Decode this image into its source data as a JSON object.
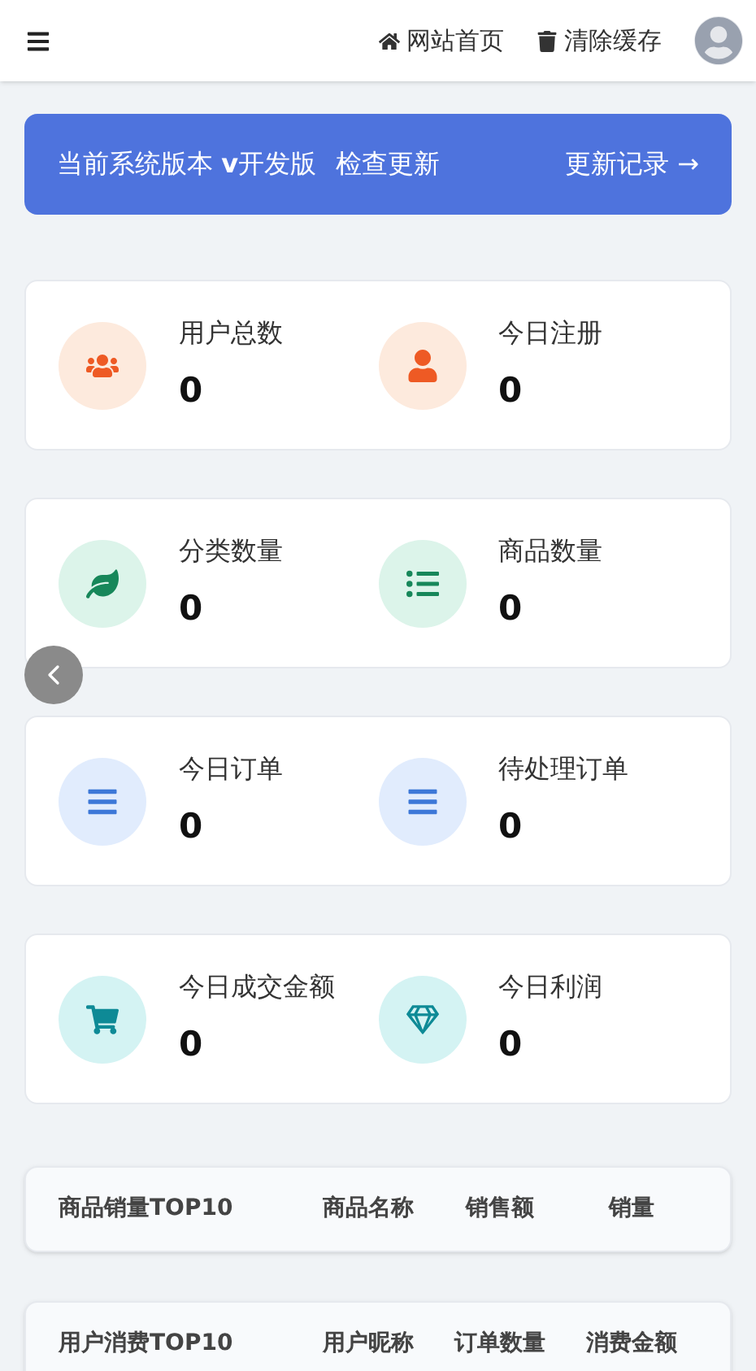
{
  "header": {
    "links": [
      {
        "kind": "home",
        "label": "网站首页"
      },
      {
        "kind": "trash",
        "label": "清除缓存"
      }
    ]
  },
  "banner": {
    "version": "当前系统版本 **v**开发版",
    "check": "检查更新",
    "changelog": "更新记录 →"
  },
  "stat_cards": [
    {
      "items": [
        {
          "kind": "users",
          "color": "#ee5a24",
          "label": "用户总数",
          "value": "0"
        },
        {
          "kind": "user",
          "color": "#ee5a24",
          "label": "今日注册",
          "value": "0"
        }
      ]
    },
    {
      "items": [
        {
          "kind": "leaf",
          "color": "#17875a",
          "label": "分类数量",
          "value": "0"
        },
        {
          "kind": "list",
          "color": "#17875a",
          "label": "商品数量",
          "value": "0"
        }
      ]
    },
    {
      "items": [
        {
          "kind": "bars",
          "color": "#3d78d8",
          "label": "今日订单",
          "value": "0"
        },
        {
          "kind": "bars",
          "color": "#3d78d8",
          "label": "待处理订单",
          "value": "0"
        }
      ]
    },
    {
      "items": [
        {
          "kind": "cart",
          "color": "#0e8a96",
          "label": "今日成交金额",
          "value": "0"
        },
        {
          "kind": "gem",
          "color": "#0e8a96",
          "label": "今日利润",
          "value": "0"
        }
      ]
    }
  ],
  "tables": [
    {
      "columns": [
        "商品销量TOP10",
        "商品名称",
        "销售额",
        "销量"
      ]
    },
    {
      "columns": [
        "用户消费TOP10",
        "用户昵称",
        "订单数量",
        "消费金额"
      ]
    }
  ]
}
